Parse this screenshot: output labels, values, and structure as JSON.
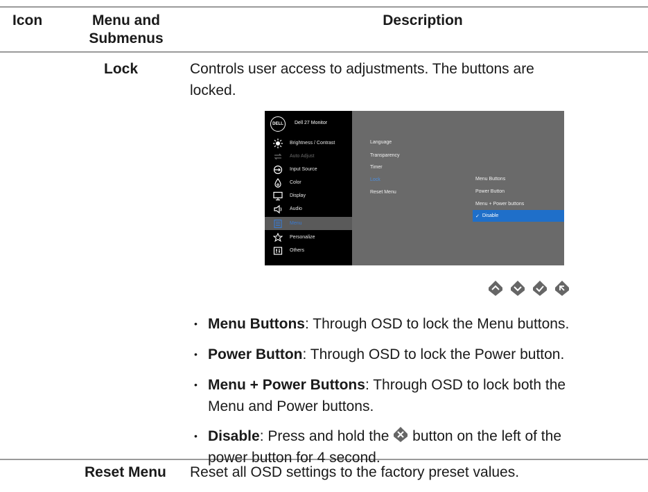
{
  "header": {
    "icon_col": "Icon",
    "menu_col_line1": "Menu and",
    "menu_col_line2": "Submenus",
    "desc_col": "Description"
  },
  "lock_row": {
    "name": "Lock",
    "description_line1": "Controls user access to adjustments. The buttons are",
    "description_line2": "locked."
  },
  "osd": {
    "logo": "DELL",
    "title": "Dell 27 Monitor",
    "menu_items": [
      {
        "label": "Brightness / Contrast",
        "icon": "brightness-icon",
        "state": "normal"
      },
      {
        "label": "Auto Adjust",
        "icon": "auto-adjust-icon",
        "state": "dim"
      },
      {
        "label": "Input Source",
        "icon": "input-source-icon",
        "state": "normal"
      },
      {
        "label": "Color",
        "icon": "color-icon",
        "state": "normal"
      },
      {
        "label": "Display",
        "icon": "display-icon",
        "state": "normal"
      },
      {
        "label": "Audio",
        "icon": "audio-icon",
        "state": "normal"
      },
      {
        "label": "Menu",
        "icon": "menu-icon",
        "state": "selected"
      },
      {
        "label": "Personalize",
        "icon": "star-icon",
        "state": "normal"
      },
      {
        "label": "Others",
        "icon": "others-icon",
        "state": "normal"
      }
    ],
    "submenu": [
      "Language",
      "Transparency",
      "Timer",
      "Lock",
      "Reset Menu"
    ],
    "options": [
      "Menu Buttons",
      "Power Button",
      "Menu + Power buttons",
      "Disable"
    ],
    "selected_check": "✓",
    "accent_color": "#1f6fc9"
  },
  "nav_buttons": [
    "up-icon",
    "down-icon",
    "check-icon",
    "back-icon"
  ],
  "bullets": [
    {
      "bold": "Menu Buttons",
      "rest": ": Through OSD to lock the Menu buttons."
    },
    {
      "bold": "Power Button",
      "rest": ": Through OSD to lock the Power button."
    },
    {
      "bold": "Menu + Power Buttons",
      "rest": ": Through OSD to lock both the",
      "line2": "Menu and Power buttons."
    },
    {
      "bold": "Disable",
      "rest_before_icon": ": Press and hold the ",
      "rest_after_icon": " button on the left of the",
      "line2": "power button for 4 second."
    }
  ],
  "reset_row": {
    "name": "Reset Menu",
    "description": "Reset all OSD settings to the factory preset values."
  }
}
